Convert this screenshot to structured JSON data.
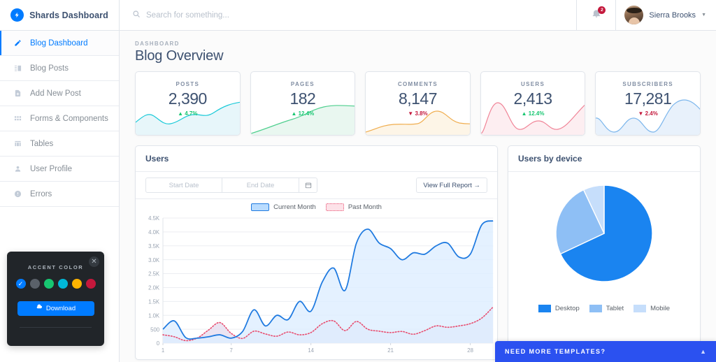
{
  "brand": {
    "name": "Shards Dashboard",
    "logo_icon": "bolt-circle-icon"
  },
  "sidebar": {
    "items": [
      {
        "label": "Blog Dashboard",
        "icon": "pencil-icon",
        "active": true
      },
      {
        "label": "Blog Posts",
        "icon": "list-view-icon",
        "active": false
      },
      {
        "label": "Add New Post",
        "icon": "file-add-icon",
        "active": false
      },
      {
        "label": "Forms & Components",
        "icon": "grid-icon",
        "active": false
      },
      {
        "label": "Tables",
        "icon": "table-icon",
        "active": false
      },
      {
        "label": "User Profile",
        "icon": "person-icon",
        "active": false
      },
      {
        "label": "Errors",
        "icon": "alert-circle-icon",
        "active": false
      }
    ]
  },
  "accent_widget": {
    "title": "ACCENT COLOR",
    "close_icon": "close-icon",
    "download_label": "Download",
    "download_icon": "cloud-icon",
    "swatches": [
      {
        "name": "blue",
        "color": "#007bff",
        "selected": true
      },
      {
        "name": "gray",
        "color": "#5a6169",
        "selected": false
      },
      {
        "name": "green",
        "color": "#17c671",
        "selected": false
      },
      {
        "name": "cyan",
        "color": "#00b8d8",
        "selected": false
      },
      {
        "name": "yellow",
        "color": "#ffb400",
        "selected": false
      },
      {
        "name": "red",
        "color": "#c4183c",
        "selected": false
      }
    ]
  },
  "topbar": {
    "search_placeholder": "Search for something...",
    "search_value": "",
    "search_icon": "search-icon",
    "bell_icon": "bell-icon",
    "notification_count": "2",
    "user_name": "Sierra Brooks",
    "caret_icon": "chevron-down-icon"
  },
  "page": {
    "breadcrumb": "DASHBOARD",
    "title": "Blog Overview"
  },
  "stats": [
    {
      "label": "POSTS",
      "value": "2,390",
      "change": "4.7%",
      "direction": "up",
      "color": "#17c9d8"
    },
    {
      "label": "PAGES",
      "value": "182",
      "change": "12.4%",
      "direction": "up",
      "color": "#4ecf8e"
    },
    {
      "label": "COMMENTS",
      "value": "8,147",
      "change": "3.8%",
      "direction": "down",
      "color": "#f0ad4e"
    },
    {
      "label": "USERS",
      "value": "2,413",
      "change": "12.4%",
      "direction": "up",
      "color": "#f08497"
    },
    {
      "label": "SUBSCRIBERS",
      "value": "17,281",
      "change": "2.4%",
      "direction": "down",
      "color": "#7cb6ec"
    }
  ],
  "users_panel": {
    "title": "Users",
    "start_date_placeholder": "Start Date",
    "end_date_placeholder": "End Date",
    "start_date_value": "",
    "end_date_value": "",
    "calendar_icon": "calendar-icon",
    "report_button": "View Full Report →"
  },
  "device_panel": {
    "title": "Users by device"
  },
  "banner": {
    "text": "NEED MORE TEMPLATES?",
    "chevron_icon": "chevron-up-icon"
  },
  "chart_data": [
    {
      "type": "line",
      "title": "Users",
      "xlabel": "",
      "ylabel": "",
      "ylim": [
        0,
        4500
      ],
      "yticks": [
        "0",
        "500",
        "1.0K",
        "1.5K",
        "2.0K",
        "2.5K",
        "3.0K",
        "3.5K",
        "4.0K",
        "4.5K"
      ],
      "xticks": [
        "1",
        "7",
        "14",
        "21",
        "28"
      ],
      "x": [
        1,
        2,
        3,
        4,
        5,
        6,
        7,
        8,
        9,
        10,
        11,
        12,
        13,
        14,
        15,
        16,
        17,
        18,
        19,
        20,
        21,
        22,
        23,
        24,
        25,
        26,
        27,
        28,
        29,
        30
      ],
      "grid": true,
      "legend_position": "top-center",
      "series": [
        {
          "name": "Current Month",
          "style": "solid-area",
          "color": "#1f7ae0",
          "fill": "#ddeeff",
          "values": [
            500,
            800,
            200,
            180,
            230,
            300,
            180,
            420,
            1200,
            620,
            1000,
            850,
            1500,
            1150,
            2200,
            2700,
            1900,
            3600,
            4100,
            3600,
            3400,
            3000,
            3250,
            3200,
            3500,
            3600,
            3100,
            3200,
            4250,
            4400
          ]
        },
        {
          "name": "Past Month",
          "style": "dotted-area",
          "color": "#e84d6f",
          "fill": "#e8dff0",
          "values": [
            300,
            230,
            90,
            180,
            470,
            740,
            350,
            170,
            430,
            330,
            250,
            400,
            300,
            380,
            700,
            800,
            450,
            780,
            500,
            430,
            380,
            420,
            320,
            450,
            620,
            570,
            620,
            700,
            900,
            1300
          ]
        }
      ]
    },
    {
      "type": "pie",
      "title": "Users by device",
      "labels": [
        "Desktop",
        "Tablet",
        "Mobile"
      ],
      "values": [
        68,
        25,
        7
      ],
      "colors": [
        "#1a84f0",
        "#8ebff5",
        "#c6defb"
      ],
      "legend_position": "bottom-center"
    }
  ]
}
